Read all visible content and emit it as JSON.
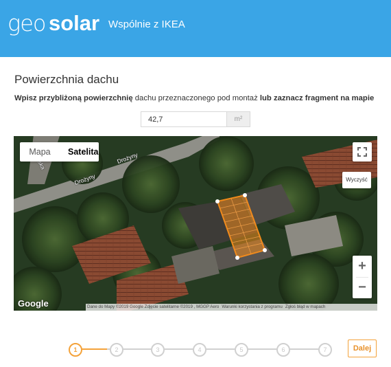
{
  "header": {
    "logo_geo": "geo",
    "logo_solar": "solar",
    "subtitle": "Wspólnie z IKEA",
    "background_color": "#3aa5e6"
  },
  "main": {
    "section_title": "Powierzchnia dachu",
    "instructions": {
      "part1_bold": "Wpisz przybliżoną powierzchnię",
      "part2": " dachu przeznaczonego pod montaż ",
      "part3_bold": "lub zaznacz fragment na mapie"
    },
    "area_input": {
      "value": "42,7",
      "unit": "m²"
    }
  },
  "map": {
    "type_map_label": "Mapa",
    "type_satellite_label": "Satelita",
    "selected_type": "Satelita",
    "fullscreen_icon": "fullscreen-icon",
    "clear_label": "Wyczyść",
    "zoom_in_label": "+",
    "zoom_out_label": "−",
    "street_labels": [
      "Drożyny",
      "Drożyny",
      "ska"
    ],
    "google_label": "Google",
    "attribution": {
      "data": "Dane do Mapy ©2019 Google Zdjęcie satelitarne ©2019 , MGGP Aero",
      "terms": "Warunki korzystania z programu",
      "report": "Zgłoś błąd w mapach"
    },
    "selection_color": "#f08a1c"
  },
  "stepper": {
    "steps": [
      "1",
      "2",
      "3",
      "4",
      "5",
      "6",
      "7"
    ],
    "current_step": 1,
    "active_color": "#f4a23a"
  },
  "footer": {
    "next_label": "Dalej"
  }
}
